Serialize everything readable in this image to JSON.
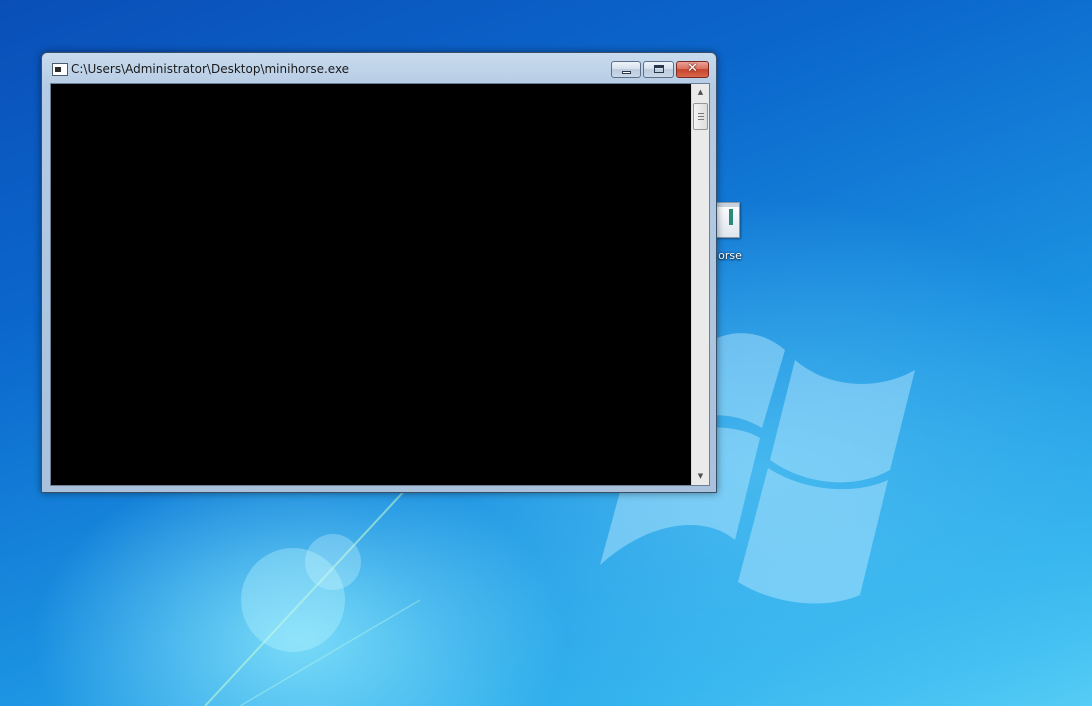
{
  "window": {
    "title": "C:\\Users\\Administrator\\Desktop\\minihorse.exe",
    "app_icon": "console-app-icon",
    "controls": {
      "minimize": "minimize-icon",
      "maximize": "maximize-icon",
      "close_glyph": "✕"
    },
    "scrollbar": {
      "up_arrow": "▲",
      "down_arrow": "▼",
      "position": 0
    },
    "console_background": "#000000"
  },
  "desktop": {
    "icon_label": "orse",
    "icon": "executable-file-icon",
    "wallpaper": "windows-7-default",
    "accent": "#1a8fe0"
  }
}
